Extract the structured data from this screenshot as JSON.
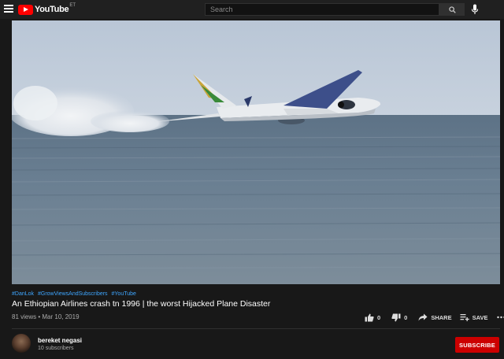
{
  "header": {
    "logo_text": "YouTube",
    "logo_sup": "ET",
    "search_placeholder": "Search"
  },
  "video": {
    "hashtags": [
      "#DanLok",
      "#GrowViewsAndSubscribers",
      "#YouTube"
    ],
    "title": "An Ethiopian Airlines crash tn 1996 | the worst Hijacked Plane Disaster",
    "views": "81 views",
    "date": "Mar 10, 2019"
  },
  "actions": {
    "like_count": "0",
    "dislike_count": "0",
    "share_label": "SHARE",
    "save_label": "SAVE"
  },
  "channel": {
    "name": "bereket negasi",
    "subscribers": "10 subscribers",
    "subscribe_label": "SUBSCRIBE"
  },
  "colors": {
    "accent": "#cc0000",
    "link": "#3ea6ff",
    "background": "#181818"
  },
  "icons": [
    "menu-icon",
    "youtube-logo",
    "search-icon",
    "mic-icon",
    "thumbs-up-icon",
    "thumbs-down-icon",
    "share-icon",
    "save-playlist-icon",
    "more-icon"
  ]
}
